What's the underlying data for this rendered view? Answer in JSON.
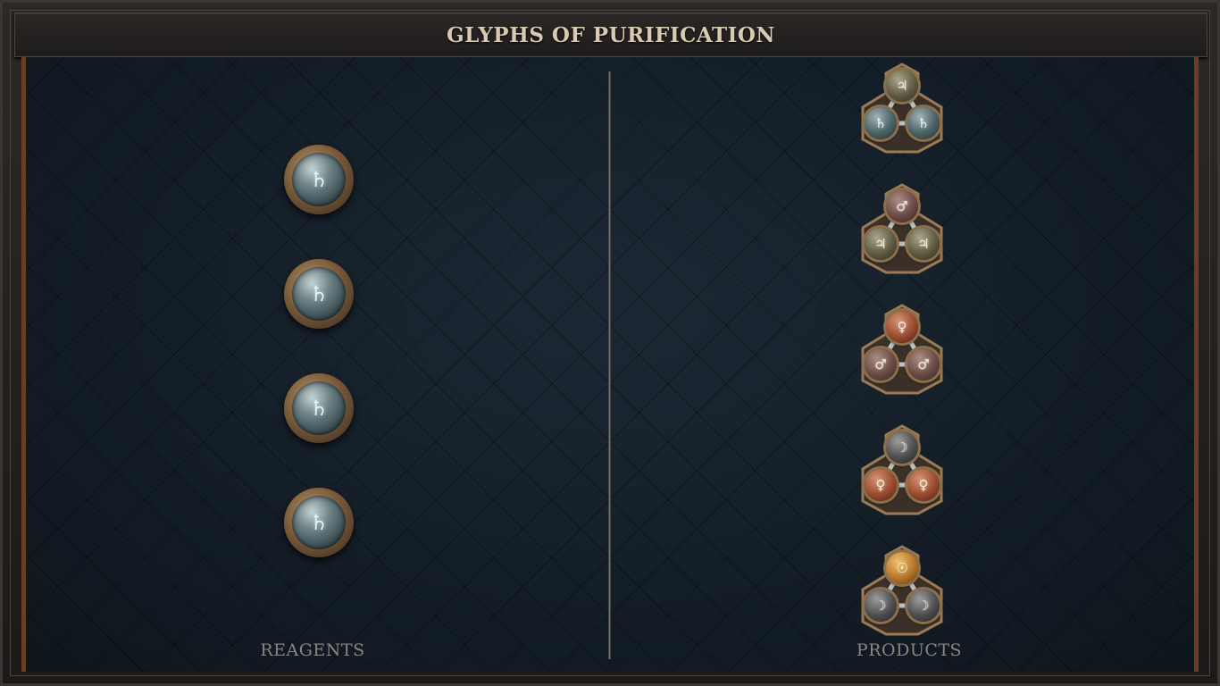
{
  "title": "GLYPHS OF PURIFICATION",
  "columns": {
    "reagents_label": "REAGENTS",
    "products_label": "PRODUCTS"
  },
  "reagents": [
    {
      "element": "lead",
      "symbol": "♄"
    },
    {
      "element": "lead",
      "symbol": "♄"
    },
    {
      "element": "lead",
      "symbol": "♄"
    },
    {
      "element": "lead",
      "symbol": "♄"
    }
  ],
  "products": [
    {
      "top": {
        "element": "tin",
        "symbol": "♃"
      },
      "left": {
        "element": "lead",
        "symbol": "♄"
      },
      "right": {
        "element": "lead",
        "symbol": "♄"
      }
    },
    {
      "top": {
        "element": "iron",
        "symbol": "♂"
      },
      "left": {
        "element": "tin",
        "symbol": "♃"
      },
      "right": {
        "element": "tin",
        "symbol": "♃"
      }
    },
    {
      "top": {
        "element": "copper",
        "symbol": "♀"
      },
      "left": {
        "element": "iron",
        "symbol": "♂"
      },
      "right": {
        "element": "iron",
        "symbol": "♂"
      }
    },
    {
      "top": {
        "element": "silver",
        "symbol": "☽"
      },
      "left": {
        "element": "copper",
        "symbol": "♀"
      },
      "right": {
        "element": "copper",
        "symbol": "♀"
      }
    },
    {
      "top": {
        "element": "gold",
        "symbol": "☉"
      },
      "left": {
        "element": "silver",
        "symbol": "☽"
      },
      "right": {
        "element": "silver",
        "symbol": "☽"
      }
    }
  ],
  "colors": {
    "board": "#131d27",
    "frame": "#2b2826",
    "accent_copper": "#6b3e22",
    "title_text": "#d8cab2",
    "label_text": "#8c867f"
  }
}
